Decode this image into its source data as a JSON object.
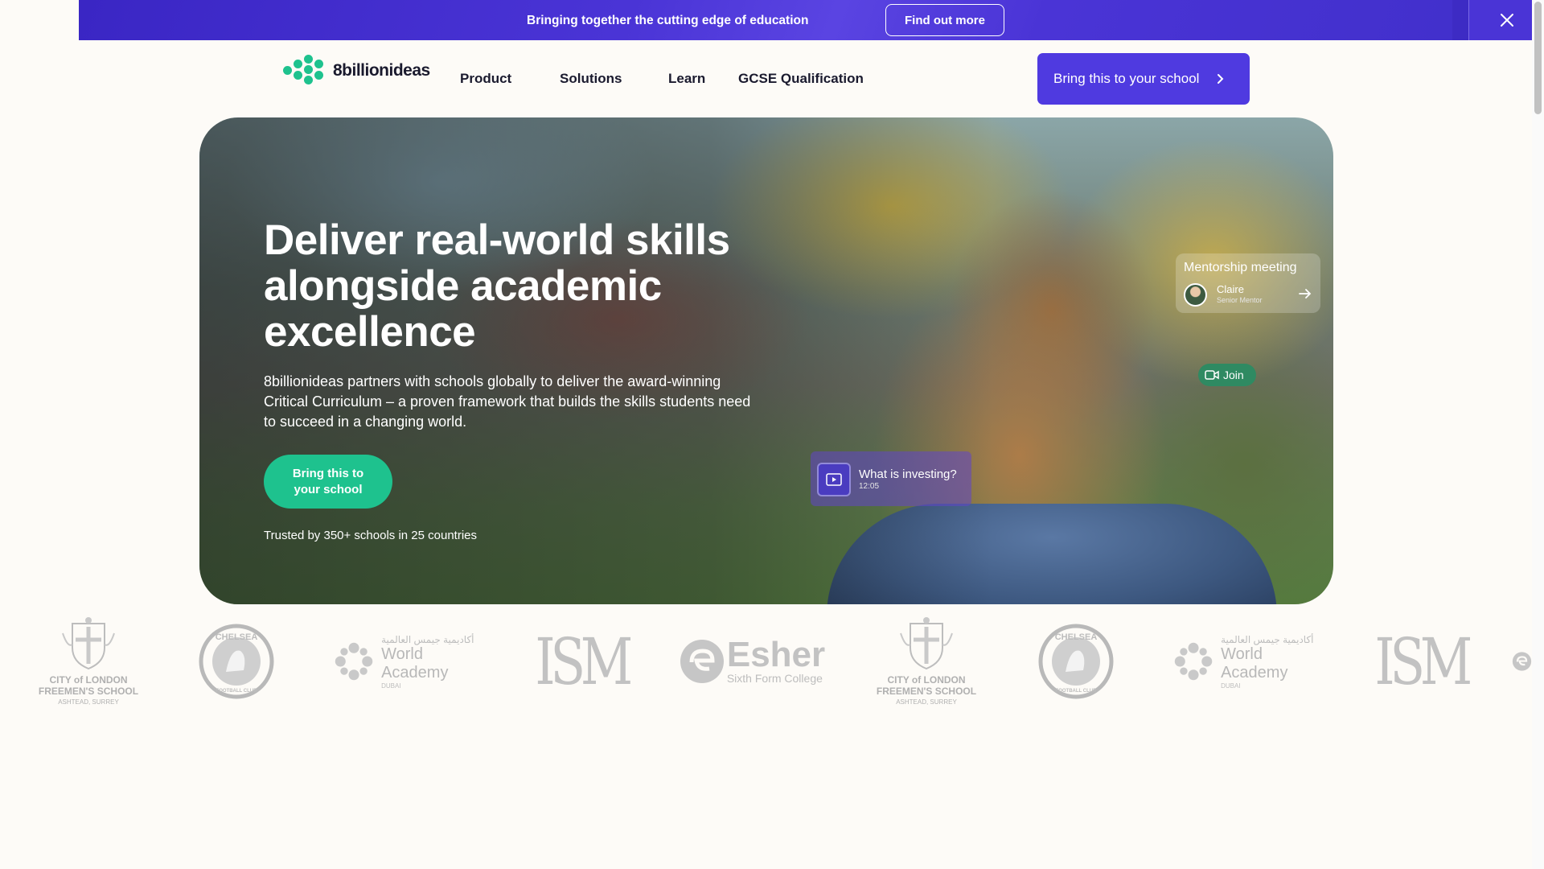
{
  "banner": {
    "text": "Bringing together the cutting edge of education",
    "button_label": "Find out more",
    "close_icon": "close-icon"
  },
  "nav": {
    "logo_text": "8billionideas",
    "items": [
      "Product",
      "Solutions",
      "Learn",
      "GCSE Qualification"
    ],
    "cta_label": "Bring this to your school"
  },
  "hero": {
    "title": "Deliver real-world skills alongside academic excellence",
    "description": "8billionideas partners with schools globally to deliver the award-winning Critical Curriculum – a proven framework that builds the skills students need to succeed in a changing world.",
    "cta_label": "Bring this to your school",
    "trust_text": "Trusted by 350+ schools in 25 countries",
    "mentor_card": {
      "title": "Mentorship meeting",
      "name": "Claire",
      "role": "Senior Mentor"
    },
    "join_label": "Join",
    "video_card": {
      "title": "What is investing?",
      "duration": "12:05"
    }
  },
  "partners": [
    {
      "name": "City of London Freemen's School",
      "line1": "CITY of LONDON",
      "line2": "FREEMEN'S SCHOOL",
      "line3": "ASHTEAD, SURREY"
    },
    {
      "name": "Chelsea Football Club",
      "line1": "CHELSEA",
      "line2": "FOOTBALL CLUB"
    },
    {
      "name": "World Academy Dubai",
      "line1": "أكاديمية جيمس العالمية",
      "line2": "World Academy",
      "line3": "DUBAI"
    },
    {
      "name": "ISM",
      "line1": "ISM"
    },
    {
      "name": "Esher Sixth Form College",
      "line1": "Esher",
      "line2": "Sixth Form College"
    }
  ],
  "colors": {
    "banner": "#4a34d6",
    "cta_purple": "#4f3ae0",
    "brand_green": "#1ec28e",
    "background": "#fdfbf7"
  }
}
